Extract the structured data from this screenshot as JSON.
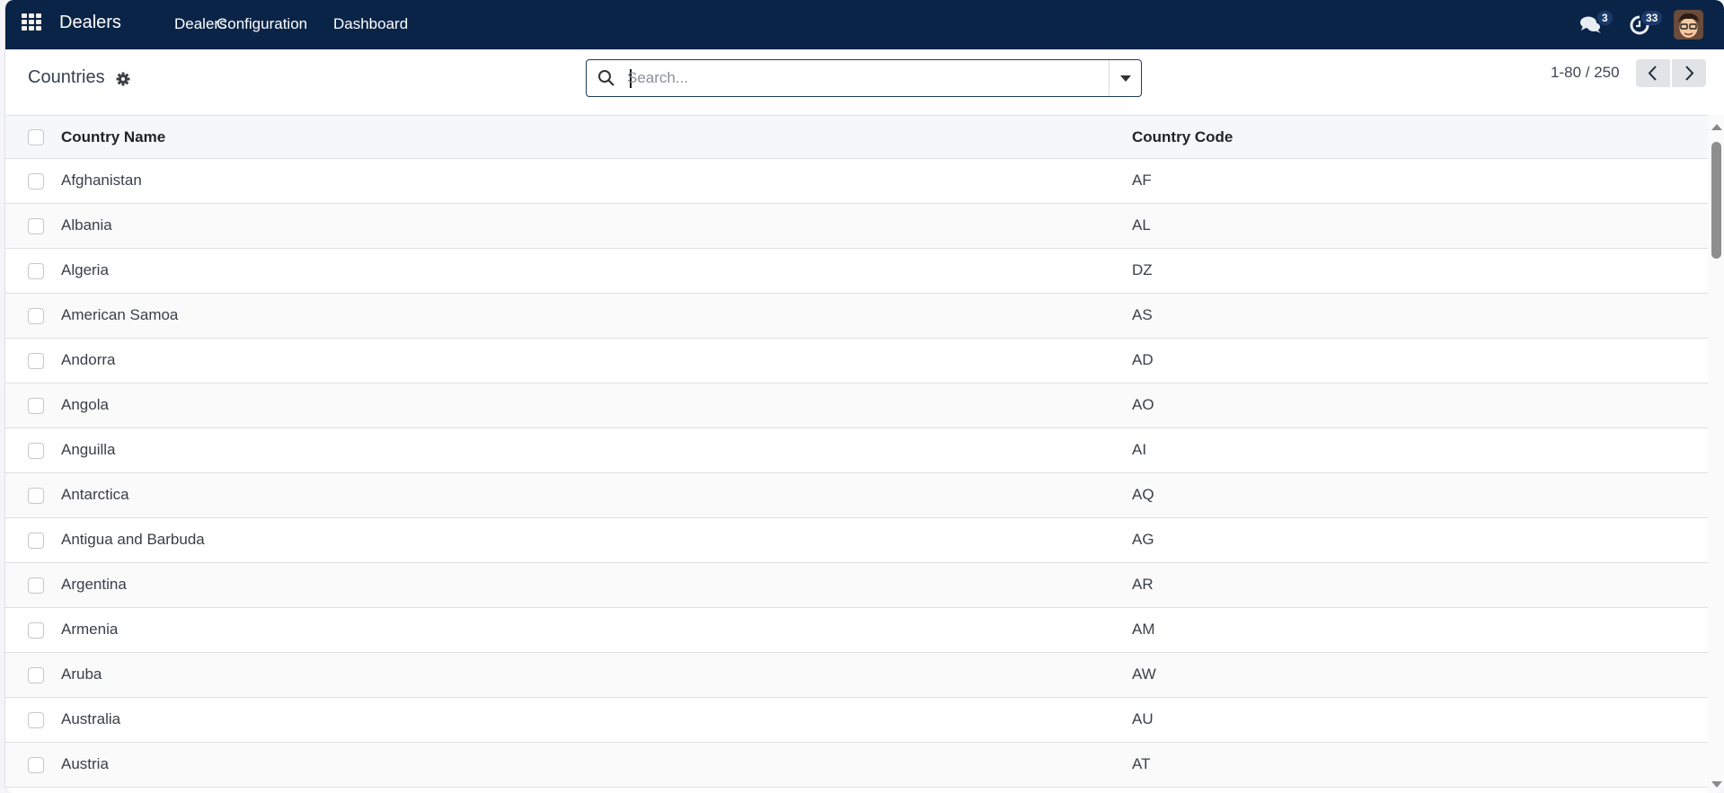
{
  "navbar": {
    "app_name": "Dealers",
    "menu": [
      {
        "label": "Dealers"
      },
      {
        "label": "Configuration"
      },
      {
        "label": "Dashboard"
      }
    ],
    "messages_count": "3",
    "activities_count": "33",
    "icons": {
      "apps": "apps-grid-icon",
      "messages": "chat-bubbles-icon",
      "activities": "clock-icon",
      "avatar": "user-avatar"
    },
    "color": "#0a2448"
  },
  "control_panel": {
    "title": "Countries",
    "search": {
      "value": "",
      "placeholder": "Search..."
    },
    "pager": {
      "value": "1-80 / 250",
      "prev_label": "Previous",
      "next_label": "Next"
    }
  },
  "table": {
    "columns": [
      {
        "label": "Country Name"
      },
      {
        "label": "Country Code"
      }
    ],
    "rows": [
      {
        "name": "Afghanistan",
        "code": "AF"
      },
      {
        "name": "Albania",
        "code": "AL"
      },
      {
        "name": "Algeria",
        "code": "DZ"
      },
      {
        "name": "American Samoa",
        "code": "AS"
      },
      {
        "name": "Andorra",
        "code": "AD"
      },
      {
        "name": "Angola",
        "code": "AO"
      },
      {
        "name": "Anguilla",
        "code": "AI"
      },
      {
        "name": "Antarctica",
        "code": "AQ"
      },
      {
        "name": "Antigua and Barbuda",
        "code": "AG"
      },
      {
        "name": "Argentina",
        "code": "AR"
      },
      {
        "name": "Armenia",
        "code": "AM"
      },
      {
        "name": "Aruba",
        "code": "AW"
      },
      {
        "name": "Australia",
        "code": "AU"
      },
      {
        "name": "Austria",
        "code": "AT"
      }
    ]
  }
}
